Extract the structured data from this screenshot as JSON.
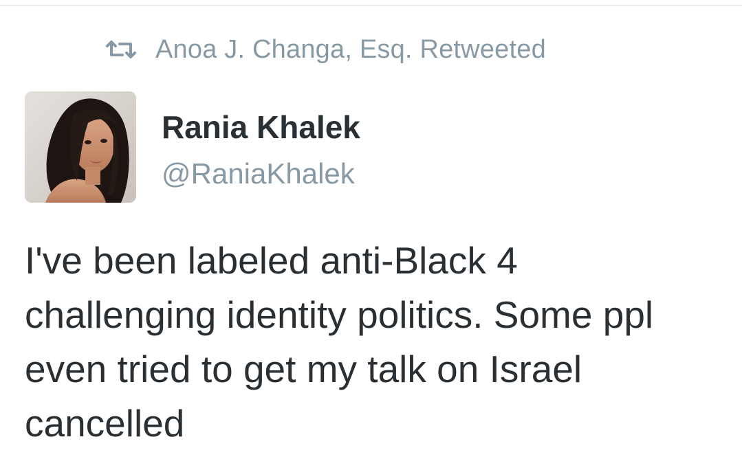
{
  "retweet": {
    "icon": "retweet-icon",
    "text": "Anoa J. Changa, Esq. Retweeted"
  },
  "author": {
    "avatar": "profile-photo",
    "display_name": "Rania Khalek",
    "handle": "@RaniaKhalek"
  },
  "tweet": {
    "text": "I've been labeled anti-Black 4\nchallenging identity politics. Some ppl\neven tried to get my talk on Israel\ncancelled"
  },
  "colors": {
    "muted": "#8899a6",
    "text": "#292f33",
    "divider": "#e6ecf0"
  }
}
